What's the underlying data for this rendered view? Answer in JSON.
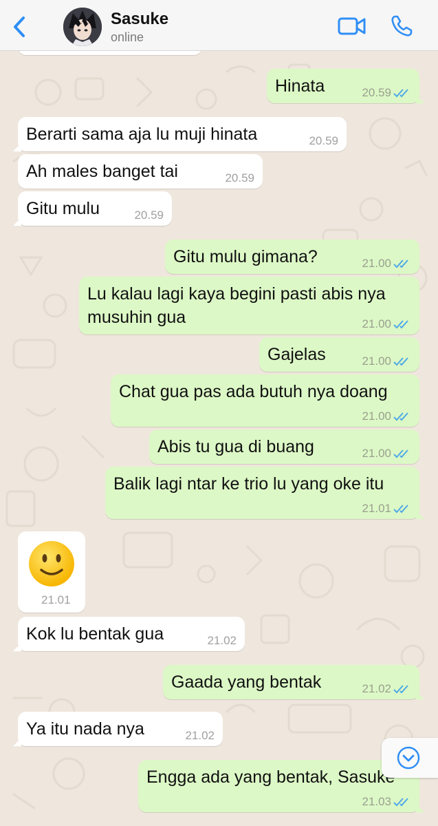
{
  "header": {
    "contact_name": "Sasuke",
    "status": "online",
    "back_icon": "chevron-left-icon",
    "video_icon": "video-camera-icon",
    "call_icon": "phone-icon",
    "accent_color": "#2f8ef5"
  },
  "messages": [
    {
      "dir": "out",
      "text": "Hinata",
      "time": "20.59"
    },
    {
      "dir": "in",
      "text": "Berarti sama aja lu muji hinata",
      "time": "20.59"
    },
    {
      "dir": "in",
      "text": "Ah males banget tai",
      "time": "20.59"
    },
    {
      "dir": "in",
      "text": "Gitu mulu",
      "time": "20.59"
    },
    {
      "dir": "out",
      "text": "Gitu mulu gimana?",
      "time": "21.00"
    },
    {
      "dir": "out",
      "text": "Lu kalau lagi kaya begini pasti abis nya musuhin gua",
      "time": "21.00"
    },
    {
      "dir": "out",
      "text": "Gajelas",
      "time": "21.00"
    },
    {
      "dir": "out",
      "text": "Chat gua pas ada butuh nya doang",
      "time": "21.00"
    },
    {
      "dir": "out",
      "text": "Abis tu gua di buang",
      "time": "21.00"
    },
    {
      "dir": "out",
      "text": "Balik lagi ntar ke trio lu yang oke itu",
      "time": "21.01"
    },
    {
      "dir": "in",
      "text": "🙂",
      "time": "21.01"
    },
    {
      "dir": "in",
      "text": "Kok lu bentak gua",
      "time": "21.02"
    },
    {
      "dir": "out",
      "text": "Gaada yang bentak",
      "time": "21.02"
    },
    {
      "dir": "in",
      "text": "Ya itu nada nya",
      "time": "21.02"
    },
    {
      "dir": "out",
      "text": "Engga ada yang bentak, Sasuke",
      "time": "21.03"
    }
  ],
  "scroll_down_icon": "chevron-down-circle-icon",
  "colors": {
    "outgoing_bubble": "#dcf8c6",
    "incoming_bubble": "#ffffff",
    "read_ticks": "#4fa9e8",
    "background": "#efe7dd"
  }
}
